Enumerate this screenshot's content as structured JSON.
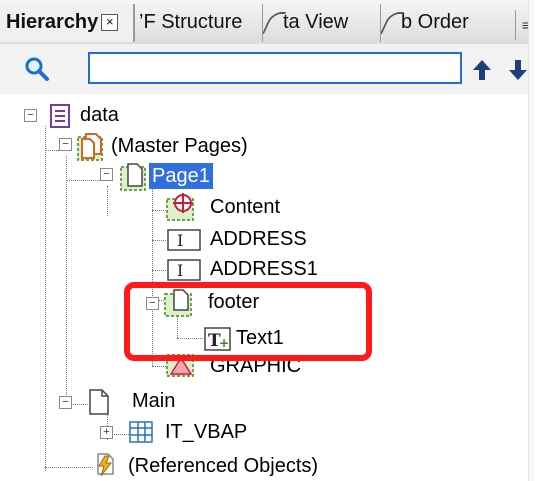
{
  "tabs": {
    "active": "Hierarchy",
    "items": [
      "’F Structure",
      "ta View",
      "b Order"
    ]
  },
  "search": {
    "value": ""
  },
  "tree": {
    "data": "data",
    "master_pages": "(Master Pages)",
    "page1": "Page1",
    "content": "Content",
    "address": "ADDRESS",
    "address1": "ADDRESS1",
    "footer": "footer",
    "text1": "Text1",
    "graphic": "GRAPHIC",
    "main": "Main",
    "it_vbap": "IT_VBAP",
    "referenced": "(Referenced Objects)"
  },
  "icons": {
    "search": "search-icon",
    "up": "arrow-up-icon",
    "down": "arrow-down-icon"
  },
  "colors": {
    "highlight": "#ff1a1a",
    "selection": "#2f6fe0",
    "search_border": "#1e6fd9"
  }
}
